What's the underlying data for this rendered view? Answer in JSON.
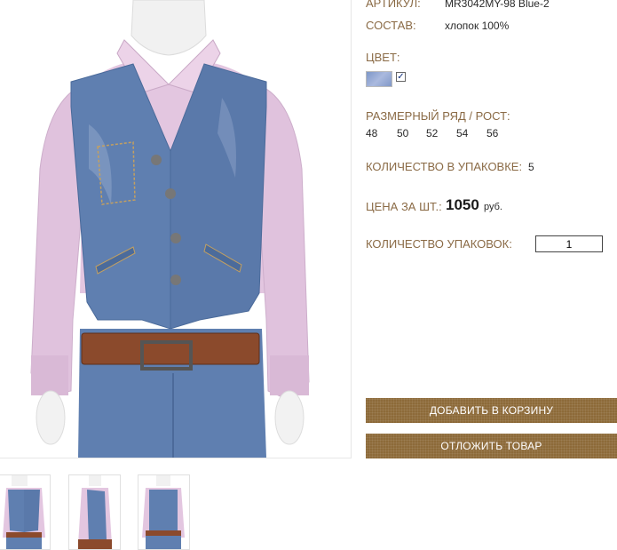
{
  "product": {
    "article_label": "АРТИКУЛ:",
    "article_value": "MR3042MY-98 Blue-2",
    "composition_label": "СОСТАВ:",
    "composition_value": "хлопок 100%",
    "color_label": "ЦВЕТ:",
    "color_checked_symbol": "✓",
    "size_label": "РАЗМЕРНЫЙ РЯД / РОСТ:",
    "sizes": [
      "48",
      "50",
      "52",
      "54",
      "56"
    ],
    "pack_label": "КОЛИЧЕСТВО В УПАКОВКЕ:",
    "pack_value": "5",
    "price_label": "ЦЕНА ЗА ШТ.:",
    "price_value": "1050",
    "price_currency": "руб.",
    "packs_label": "КОЛИЧЕСТВО УПАКОВОК:",
    "packs_value": "1"
  },
  "buttons": {
    "add_to_cart": "ДОБАВИТЬ В КОРЗИНУ",
    "postpone": "ОТЛОЖИТЬ ТОВАР"
  },
  "colors": {
    "label": "#8a6a45",
    "button": "#8d6a39",
    "denim": "#5f7fb0",
    "shirt": "#e3c6e0"
  },
  "icons": [
    "mannequin-photo",
    "thumbnail-front",
    "thumbnail-side",
    "thumbnail-back",
    "color-swatch",
    "checkbox-icon"
  ]
}
